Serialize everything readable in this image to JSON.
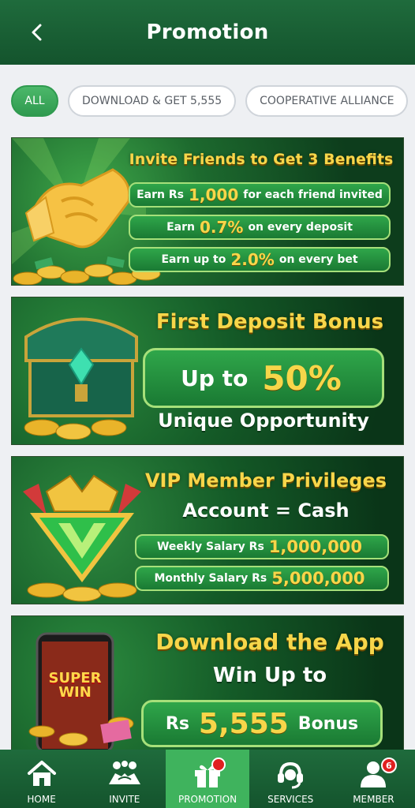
{
  "header": {
    "title": "Promotion"
  },
  "filters": [
    {
      "label": "ALL"
    },
    {
      "label": "DOWNLOAD & GET 5,555"
    },
    {
      "label": "COOPERATIVE ALLIANCE"
    }
  ],
  "banners": {
    "invite": {
      "title": "Invite Friends to Get 3 Benefits",
      "row1": {
        "pre": "Earn Rs",
        "value": "1,000",
        "post": "for each friend invited"
      },
      "row2": {
        "pre": "Earn",
        "value": "0.7%",
        "post": "on every deposit"
      },
      "row3": {
        "pre": "Earn up to",
        "value": "2.0%",
        "post": "on every bet"
      }
    },
    "deposit": {
      "title": "First Deposit Bonus",
      "pill_pre": "Up to",
      "pill_value": "50%",
      "subtitle": "Unique Opportunity"
    },
    "vip": {
      "title": "VIP Member Privileges",
      "subtitle": "Account = Cash",
      "row1": {
        "label": "Weekly Salary Rs",
        "value": "1,000,000"
      },
      "row2": {
        "label": "Monthly Salary Rs",
        "value": "5,000,000"
      }
    },
    "download": {
      "title": "Download the App",
      "subtitle": "Win Up to",
      "pill_pre": "Rs",
      "pill_value": "5,555",
      "pill_post": "Bonus",
      "phone_text1": "SUPER",
      "phone_text2": "WIN"
    }
  },
  "nav": [
    {
      "label": "HOME",
      "icon": "home-icon"
    },
    {
      "label": "INVITE",
      "icon": "invite-icon"
    },
    {
      "label": "PROMOTION",
      "icon": "gift-icon"
    },
    {
      "label": "SERVICES",
      "icon": "headset-icon"
    },
    {
      "label": "MEMBER",
      "icon": "user-icon",
      "badge": "6"
    }
  ],
  "colors": {
    "primary": "#1f6b3c",
    "accent": "#3fb35d",
    "gold": "#f7d64a",
    "badge": "#e02020"
  }
}
